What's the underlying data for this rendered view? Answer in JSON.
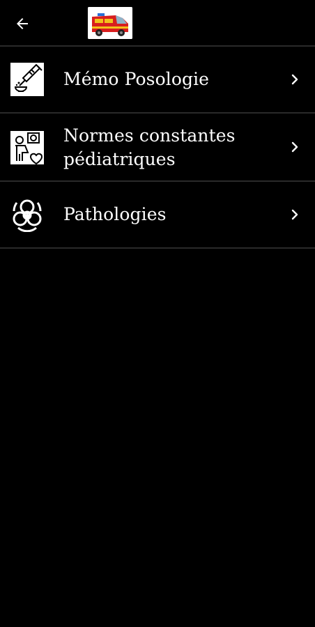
{
  "app_bar": {
    "back_icon": "arrow-left-icon",
    "logo": "ambulance-logo"
  },
  "menu": {
    "items": [
      {
        "label": "Mémo Posologie",
        "icon": "syringe-medication-icon",
        "chevron": "chevron-right-icon"
      },
      {
        "label": "Normes constantes pédiatriques",
        "icon": "pediatric-vitals-icon",
        "chevron": "chevron-right-icon"
      },
      {
        "label": "Pathologies",
        "icon": "biohazard-icon",
        "chevron": "chevron-right-icon"
      }
    ]
  },
  "colors": {
    "background": "#000000",
    "text": "#ffffff",
    "divider": "#2a2a2a"
  }
}
